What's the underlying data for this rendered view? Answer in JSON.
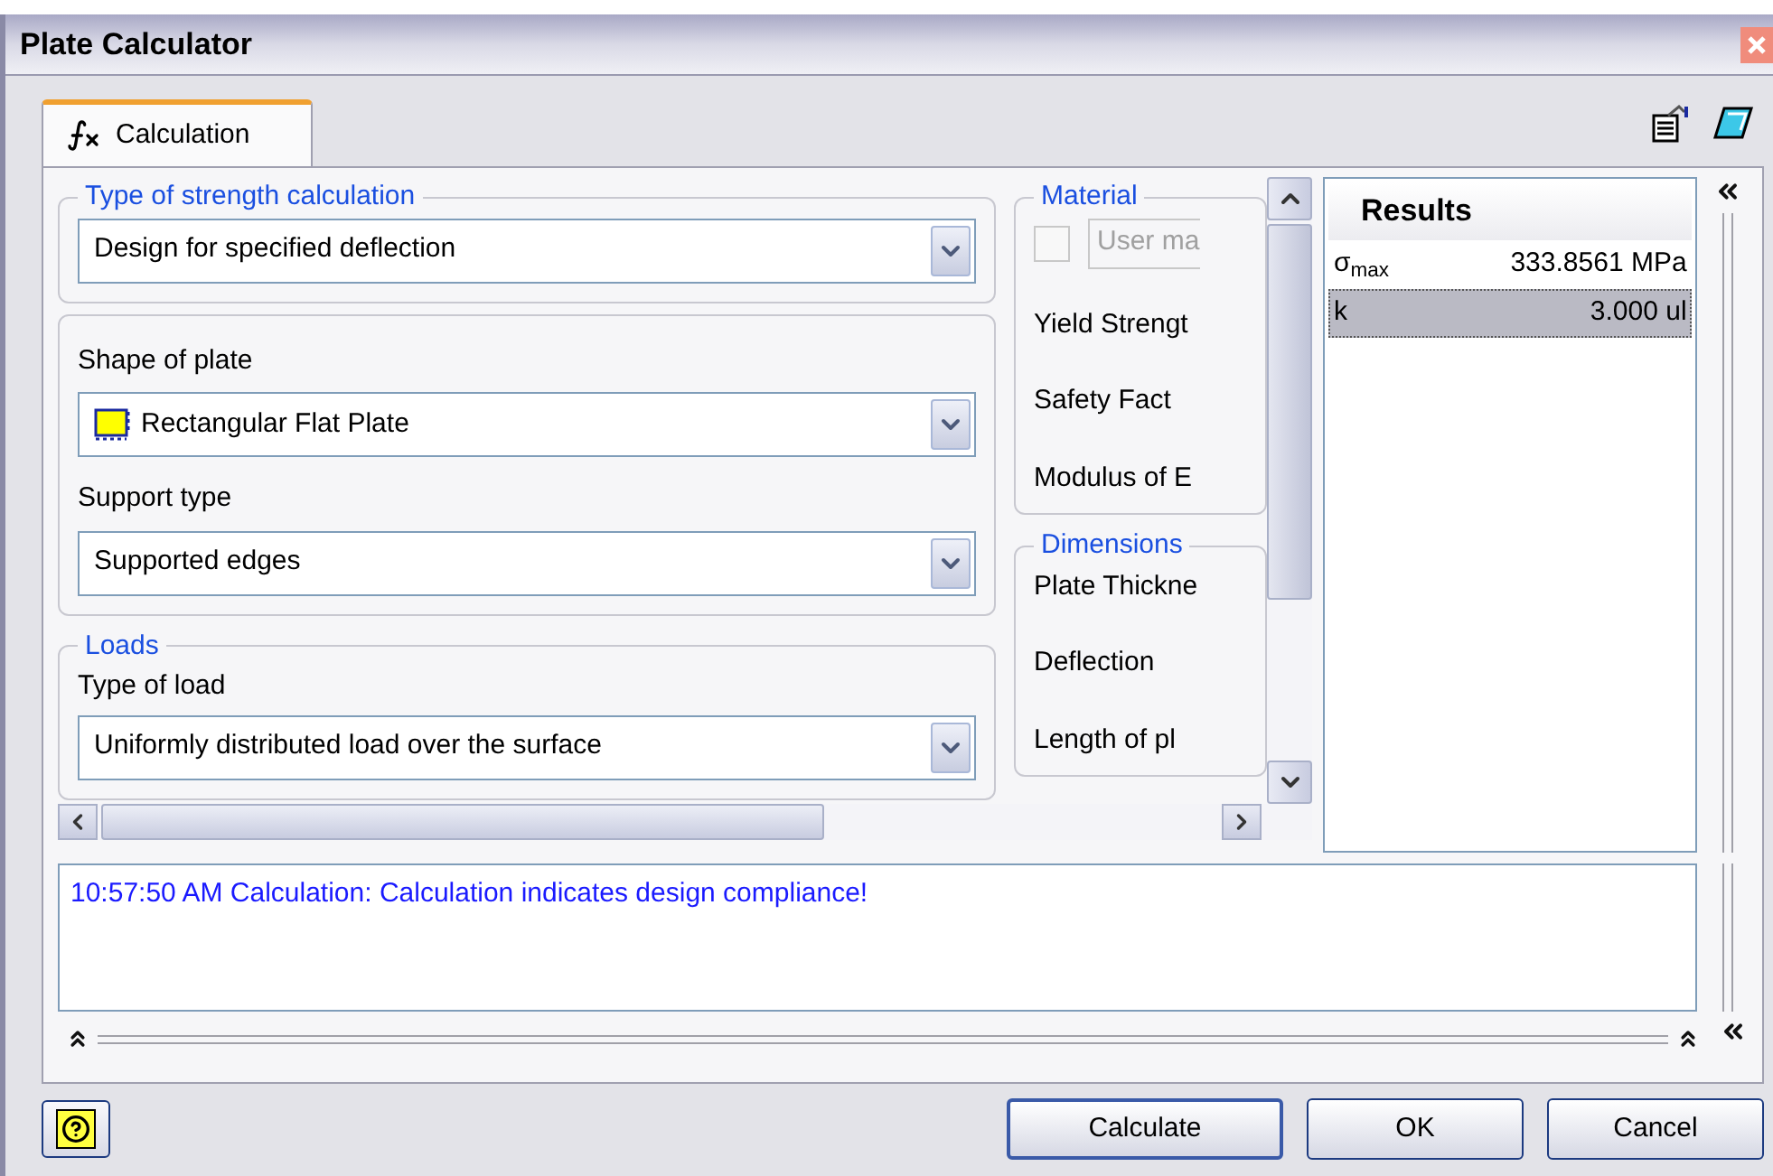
{
  "window": {
    "title": "Plate Calculator"
  },
  "tabs": [
    {
      "label": "Calculation",
      "selected": true
    }
  ],
  "strength": {
    "legend": "Type of strength calculation",
    "value": "Design for specified deflection"
  },
  "plate": {
    "shape_label": "Shape of plate",
    "shape_value": "Rectangular Flat Plate",
    "support_label": "Support type",
    "support_value": "Supported edges"
  },
  "loads": {
    "legend": "Loads",
    "load_label": "Type of load",
    "load_value": "Uniformly distributed load over the surface"
  },
  "material": {
    "legend": "Material",
    "user_checkbox": {
      "checked": false,
      "disabled": true
    },
    "user_field": "User ma",
    "rows": [
      "Yield Strengt",
      "Safety Fact",
      "Modulus of E"
    ]
  },
  "dimensions": {
    "legend": "Dimensions",
    "rows": [
      "Plate Thickne",
      "Deflection",
      "Length of pl"
    ]
  },
  "results": {
    "title": "Results",
    "rows": [
      {
        "name": "σ$_{max}$",
        "value": "333.8561 MPa",
        "selected": false
      },
      {
        "name": "k",
        "value": "3.000 ul",
        "selected": true
      }
    ]
  },
  "message": "10:57:50 AM Calculation: Calculation indicates design compliance!",
  "buttons": [
    {
      "label": "Calculate",
      "default": true
    },
    {
      "label": "OK",
      "default": false
    },
    {
      "label": "Cancel",
      "default": false
    }
  ]
}
